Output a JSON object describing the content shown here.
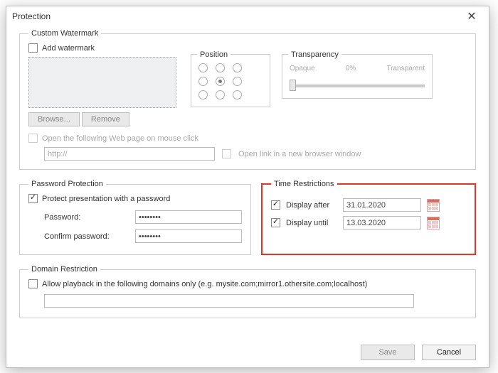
{
  "window": {
    "title": "Protection"
  },
  "watermark": {
    "legend": "Custom Watermark",
    "add_label": "Add watermark",
    "browse_label": "Browse...",
    "remove_label": "Remove",
    "position_label": "Position",
    "transparency": {
      "label": "Transparency",
      "left": "Opaque",
      "mid": "0%",
      "right": "Transparent"
    },
    "open_web_label": "Open the following Web page on mouse click",
    "url_value": "http://",
    "open_new_window_label": "Open link in a new browser window"
  },
  "password": {
    "legend": "Password Protection",
    "protect_label": "Protect presentation with a password",
    "password_label": "Password:",
    "confirm_label": "Confirm password:",
    "masked_value": "••••••••"
  },
  "time": {
    "legend": "Time Restrictions",
    "after_label": "Display after",
    "after_value": "31.01.2020",
    "until_label": "Display until",
    "until_value": "13.03.2020"
  },
  "domain": {
    "legend": "Domain Restriction",
    "allow_label": "Allow playback in the following domains only (e.g. mysite.com;mirror1.othersite.com;localhost)",
    "value": ""
  },
  "footer": {
    "save_label": "Save",
    "cancel_label": "Cancel"
  }
}
